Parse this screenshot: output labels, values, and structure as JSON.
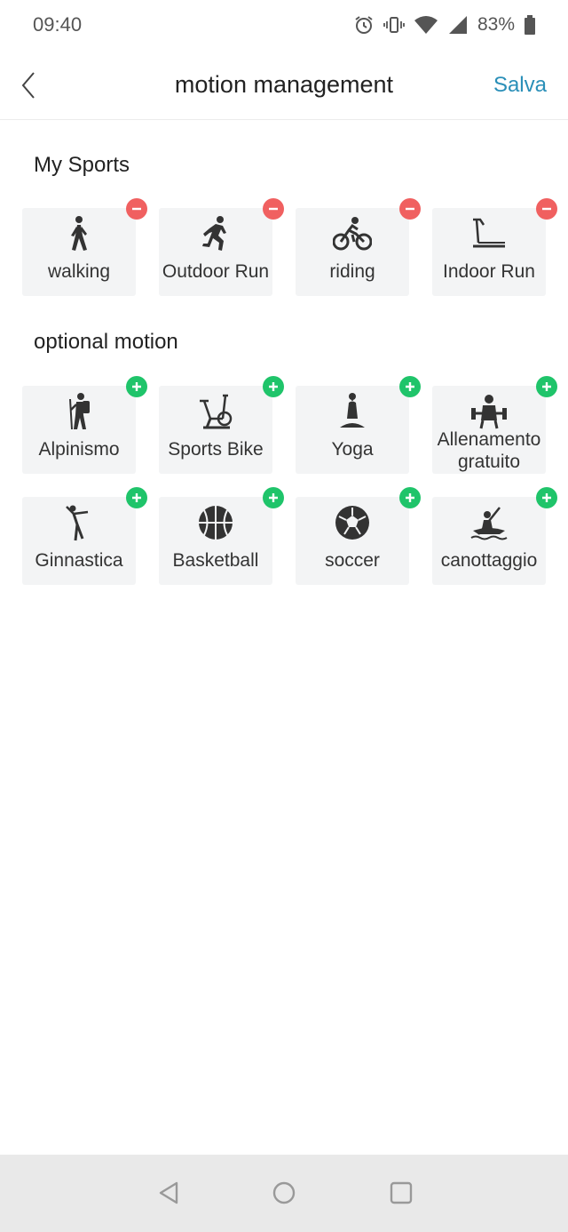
{
  "status_bar": {
    "time": "09:40",
    "battery": "83%",
    "icons": [
      "alarm-icon",
      "vibrate-icon",
      "wifi-icon",
      "signal-icon",
      "battery-icon"
    ]
  },
  "header": {
    "title": "motion management",
    "save_label": "Salva"
  },
  "my_sports": {
    "title": "My Sports",
    "items": [
      {
        "label": "walking",
        "icon": "walking-icon"
      },
      {
        "label": "Outdoor Run",
        "icon": "running-icon"
      },
      {
        "label": "riding",
        "icon": "cycling-icon"
      },
      {
        "label": "Indoor Run",
        "icon": "treadmill-icon"
      }
    ]
  },
  "optional_motion": {
    "title": "optional motion",
    "items": [
      {
        "label": "Alpinismo",
        "icon": "hiking-icon"
      },
      {
        "label": "Sports Bike",
        "icon": "exercise-bike-icon"
      },
      {
        "label": "Yoga",
        "icon": "yoga-icon"
      },
      {
        "label": "Allenamento gratuito",
        "icon": "weightlifting-icon"
      },
      {
        "label": "Ginnastica",
        "icon": "gymnastics-icon"
      },
      {
        "label": "Basketball",
        "icon": "basketball-icon"
      },
      {
        "label": "soccer",
        "icon": "soccer-ball-icon"
      },
      {
        "label": "canottaggio",
        "icon": "kayak-icon"
      }
    ]
  },
  "colors": {
    "accent": "#2a8fb8",
    "remove": "#f06060",
    "add": "#1fc46a",
    "tile_bg": "#f3f4f5",
    "icon": "#333333"
  }
}
